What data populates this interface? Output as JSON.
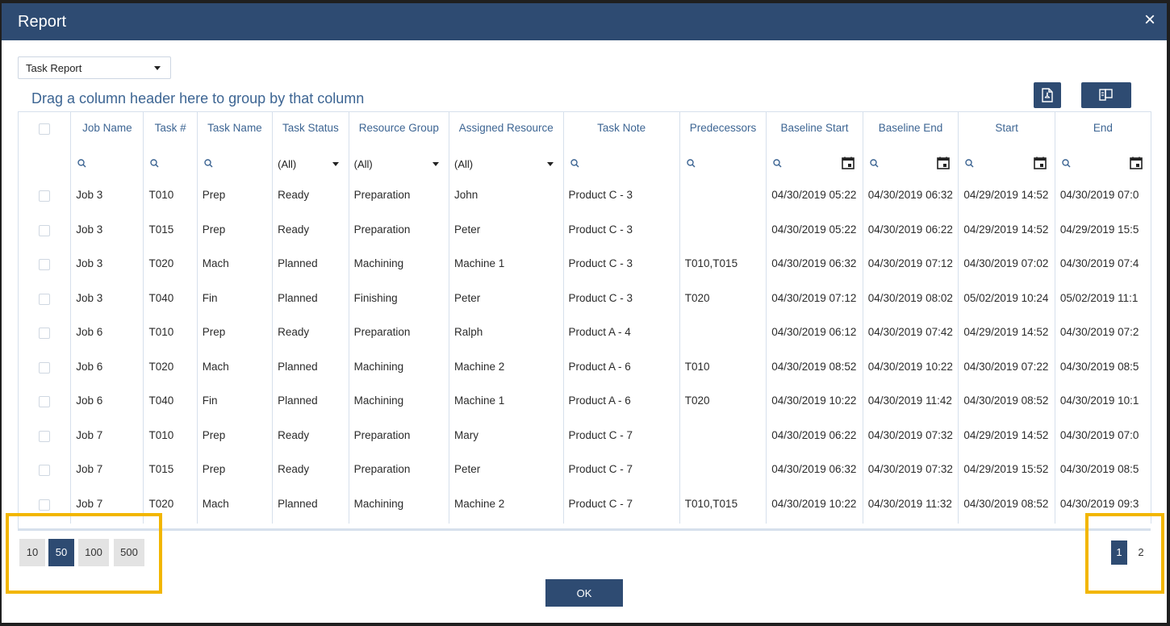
{
  "dialog": {
    "title": "Report",
    "close_symbol": "×"
  },
  "report_select": {
    "value": "Task Report"
  },
  "group_panel": {
    "text": "Drag a column header here to group by that column"
  },
  "toolbar": {
    "export_pdf_icon": "pdf-export-icon",
    "column_chooser_icon": "column-chooser-icon"
  },
  "columns": [
    "Job Name",
    "Task #",
    "Task Name",
    "Task Status",
    "Resource Group",
    "Assigned Resource",
    "Task Note",
    "Predecessors",
    "Baseline Start",
    "Baseline End",
    "Start",
    "End"
  ],
  "filters": {
    "status": "(All)",
    "resource_group": "(All)",
    "assigned_resource": "(All)"
  },
  "rows": [
    [
      "Job 3",
      "T010",
      "Prep",
      "Ready",
      "Preparation",
      "John",
      "Product C - 3",
      "",
      "04/30/2019 05:22",
      "04/30/2019 06:32",
      "04/29/2019 14:52",
      "04/30/2019 07:0"
    ],
    [
      "Job 3",
      "T015",
      "Prep",
      "Ready",
      "Preparation",
      "Peter",
      "Product C - 3",
      "",
      "04/30/2019 05:22",
      "04/30/2019 06:22",
      "04/29/2019 14:52",
      "04/29/2019 15:5"
    ],
    [
      "Job 3",
      "T020",
      "Mach",
      "Planned",
      "Machining",
      "Machine 1",
      "Product C - 3",
      "T010,T015",
      "04/30/2019 06:32",
      "04/30/2019 07:12",
      "04/30/2019 07:02",
      "04/30/2019 07:4"
    ],
    [
      "Job 3",
      "T040",
      "Fin",
      "Planned",
      "Finishing",
      "Peter",
      "Product C - 3",
      "T020",
      "04/30/2019 07:12",
      "04/30/2019 08:02",
      "05/02/2019 10:24",
      "05/02/2019 11:1"
    ],
    [
      "Job 6",
      "T010",
      "Prep",
      "Ready",
      "Preparation",
      "Ralph",
      "Product A - 4",
      "",
      "04/30/2019 06:12",
      "04/30/2019 07:42",
      "04/29/2019 14:52",
      "04/30/2019 07:2"
    ],
    [
      "Job 6",
      "T020",
      "Mach",
      "Planned",
      "Machining",
      "Machine 2",
      "Product A - 6",
      "T010",
      "04/30/2019 08:52",
      "04/30/2019 10:22",
      "04/30/2019 07:22",
      "04/30/2019 08:5"
    ],
    [
      "Job 6",
      "T040",
      "Fin",
      "Planned",
      "Machining",
      "Machine 1",
      "Product A - 6",
      "T020",
      "04/30/2019 10:22",
      "04/30/2019 11:42",
      "04/30/2019 08:52",
      "04/30/2019 10:1"
    ],
    [
      "Job 7",
      "T010",
      "Prep",
      "Ready",
      "Preparation",
      "Mary",
      "Product C - 7",
      "",
      "04/30/2019 06:22",
      "04/30/2019 07:32",
      "04/29/2019 14:52",
      "04/30/2019 07:0"
    ],
    [
      "Job 7",
      "T015",
      "Prep",
      "Ready",
      "Preparation",
      "Peter",
      "Product C - 7",
      "",
      "04/30/2019 06:32",
      "04/30/2019 07:32",
      "04/29/2019 15:52",
      "04/30/2019 08:5"
    ],
    [
      "Job 7",
      "T020",
      "Mach",
      "Planned",
      "Machining",
      "Machine 2",
      "Product C - 7",
      "T010,T015",
      "04/30/2019 10:22",
      "04/30/2019 11:32",
      "04/30/2019 08:52",
      "04/30/2019 09:3"
    ]
  ],
  "page_sizes": [
    "10",
    "50",
    "100",
    "500"
  ],
  "page_size_selected": "50",
  "pages": [
    "1",
    "2"
  ],
  "page_selected": "1",
  "ok_button": {
    "label": "OK"
  },
  "colors": {
    "primary": "#2e4b72",
    "header_text": "#3d6593",
    "highlight": "#f2b600"
  }
}
